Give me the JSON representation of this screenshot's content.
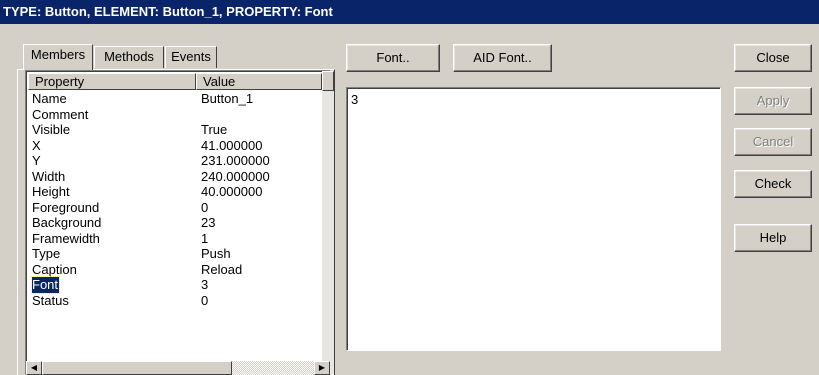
{
  "window": {
    "title": "TYPE: Button,  ELEMENT: Button_1,  PROPERTY: Font"
  },
  "tabs": [
    {
      "label": "Members",
      "active": true
    },
    {
      "label": "Methods",
      "active": false
    },
    {
      "label": "Events",
      "active": false
    }
  ],
  "columns": {
    "property": "Property",
    "value": "Value"
  },
  "properties": [
    {
      "name": "Name",
      "value": "Button_1"
    },
    {
      "name": "Comment",
      "value": ""
    },
    {
      "name": "Visible",
      "value": "True"
    },
    {
      "name": "X",
      "value": "41.000000"
    },
    {
      "name": "Y",
      "value": "231.000000"
    },
    {
      "name": "Width",
      "value": "240.000000"
    },
    {
      "name": "Height",
      "value": "40.000000"
    },
    {
      "name": "Foreground",
      "value": "0"
    },
    {
      "name": "Background",
      "value": "23"
    },
    {
      "name": "Framewidth",
      "value": "1"
    },
    {
      "name": "Type",
      "value": "Push"
    },
    {
      "name": "Caption",
      "value": "Reload"
    },
    {
      "name": "Font",
      "value": "3",
      "selected": true
    },
    {
      "name": "Status",
      "value": "0"
    }
  ],
  "editor": {
    "font_button": "Font..",
    "aid_font_button": "AID Font..",
    "value_text": "3"
  },
  "actions": {
    "close": "Close",
    "apply": "Apply",
    "cancel": "Cancel",
    "check": "Check",
    "help": "Help"
  },
  "colors": {
    "titlebar": "#0a246a",
    "face": "#d4d0c8",
    "selection": "#0a246a"
  }
}
